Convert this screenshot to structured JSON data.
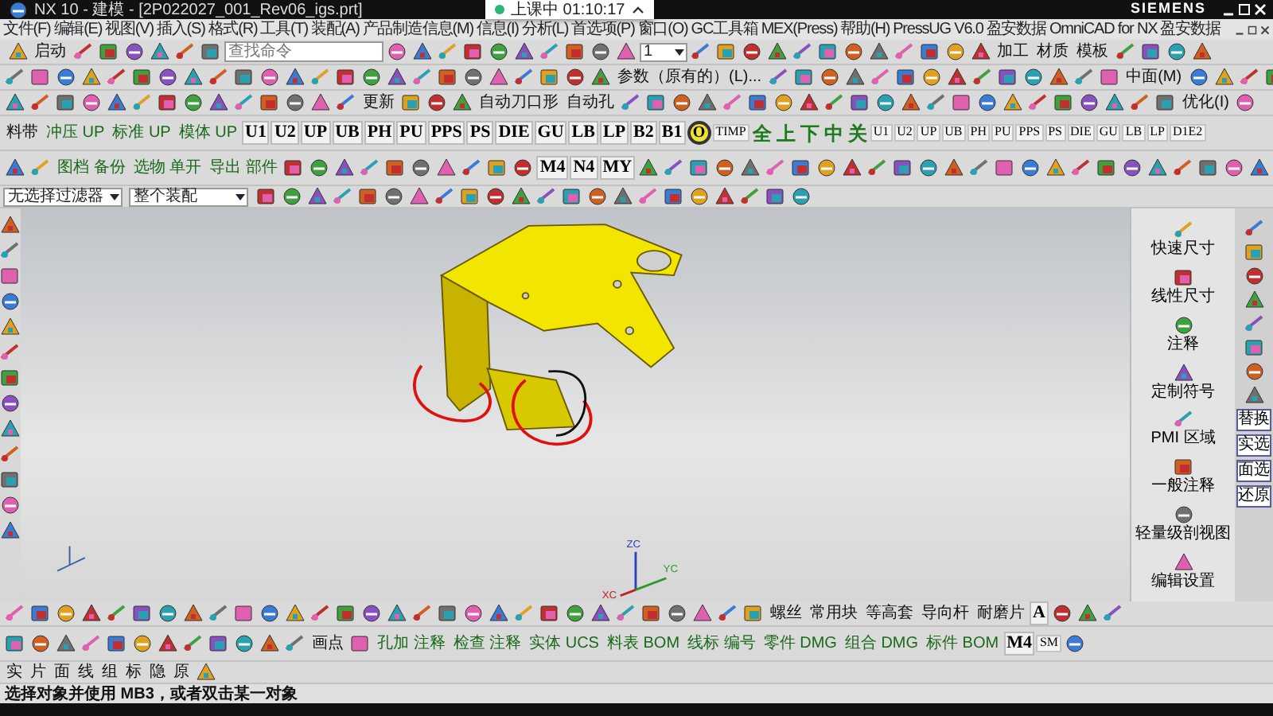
{
  "window": {
    "title": "NX 10 - 建模 - [2P022027_001_Rev06_igs.prt]",
    "brand": "SIEMENS"
  },
  "notification": {
    "text": "上课中 01:10:17"
  },
  "menu": [
    "文件(F)",
    "编辑(E)",
    "视图(V)",
    "插入(S)",
    "格式(R)",
    "工具(T)",
    "装配(A)",
    "产品制造信息(M)",
    "信息(I)",
    "分析(L)",
    "首选项(P)",
    "窗口(O)",
    "GC工具箱",
    "MEX(Press)",
    "帮助(H)",
    "PressUG V6.0",
    "盈安数据",
    "OmniCAD for NX",
    "盈安数据"
  ],
  "toolbars": [
    [
      {
        "kind": "button",
        "text": "启动"
      },
      {
        "kind": "search",
        "placeholder": "查找命令"
      },
      {
        "kind": "dropdown",
        "text": "1"
      },
      {
        "kind": "label",
        "text": "加工"
      },
      {
        "kind": "label",
        "text": "材质"
      },
      {
        "kind": "label",
        "text": "模板"
      }
    ],
    [
      {
        "kind": "label",
        "text": "参数（原有的）(L)..."
      },
      {
        "kind": "label",
        "text": "中面(M)"
      }
    ],
    [
      {
        "kind": "label",
        "text": "更新"
      },
      {
        "kind": "label",
        "text": "自动刀口形"
      },
      {
        "kind": "label",
        "text": "自动孔"
      },
      {
        "kind": "label",
        "text": "优化(I)"
      }
    ],
    [
      {
        "kind": "label",
        "text": "料带"
      },
      {
        "kind": "stack",
        "text": "冲压 UP"
      },
      {
        "kind": "stack",
        "text": "标准 UP"
      },
      {
        "kind": "stack",
        "text": "模体 UP"
      },
      {
        "kind": "code",
        "text": "U1"
      },
      {
        "kind": "code",
        "text": "U2"
      },
      {
        "kind": "code",
        "text": "UP"
      },
      {
        "kind": "code",
        "text": "UB"
      },
      {
        "kind": "code",
        "text": "PH"
      },
      {
        "kind": "code",
        "text": "PU"
      },
      {
        "kind": "code",
        "text": "PPS"
      },
      {
        "kind": "code",
        "text": "PS"
      },
      {
        "kind": "code",
        "text": "DIE"
      },
      {
        "kind": "code",
        "text": "GU"
      },
      {
        "kind": "code",
        "text": "LB"
      },
      {
        "kind": "code",
        "text": "LP"
      },
      {
        "kind": "code",
        "text": "B2"
      },
      {
        "kind": "code",
        "text": "B1"
      },
      {
        "kind": "ring",
        "text": "O"
      },
      {
        "kind": "small",
        "text": "TIMP"
      },
      {
        "kind": "glyph",
        "text": "全"
      },
      {
        "kind": "glyph",
        "text": "上"
      },
      {
        "kind": "glyph",
        "text": "下"
      },
      {
        "kind": "glyph",
        "text": "中"
      },
      {
        "kind": "glyph",
        "text": "关"
      },
      {
        "kind": "small",
        "text": "U1"
      },
      {
        "kind": "small",
        "text": "U2"
      },
      {
        "kind": "small",
        "text": "UP"
      },
      {
        "kind": "small",
        "text": "UB"
      },
      {
        "kind": "small",
        "text": "PH"
      },
      {
        "kind": "small",
        "text": "PU"
      },
      {
        "kind": "small",
        "text": "PPS"
      },
      {
        "kind": "small",
        "text": "PS"
      },
      {
        "kind": "small",
        "text": "DIE"
      },
      {
        "kind": "small",
        "text": "GU"
      },
      {
        "kind": "small",
        "text": "LB"
      },
      {
        "kind": "small",
        "text": "LP"
      },
      {
        "kind": "small",
        "text": "D1E2"
      }
    ],
    [
      {
        "kind": "stack",
        "text": "图档 备份"
      },
      {
        "kind": "stack",
        "text": "选物 单开"
      },
      {
        "kind": "stack",
        "text": "导出 部件"
      },
      {
        "kind": "code",
        "text": "M4"
      },
      {
        "kind": "code",
        "text": "N4"
      },
      {
        "kind": "code",
        "text": "MY"
      }
    ],
    [
      {
        "kind": "filter",
        "text": "无选择过滤器"
      },
      {
        "kind": "filter",
        "text": "整个装配"
      }
    ]
  ],
  "right_panel": [
    "快速尺寸",
    "线性尺寸",
    "注释",
    "定制符号",
    "PMI 区域",
    "一般注释",
    "轻量级剖视图",
    "编辑设置"
  ],
  "side_buttons": [
    "替换",
    "实选",
    "面选",
    "还原"
  ],
  "triad": {
    "z": "ZC",
    "y": "YC",
    "x": "XC"
  },
  "bottom_toolbars": [
    [
      {
        "kind": "label",
        "text": "螺丝"
      },
      {
        "kind": "label",
        "text": "常用块"
      },
      {
        "kind": "label",
        "text": "等高套"
      },
      {
        "kind": "label",
        "text": "导向杆"
      },
      {
        "kind": "label",
        "text": "耐磨片"
      },
      {
        "kind": "code",
        "text": "A"
      }
    ],
    [
      {
        "kind": "label",
        "text": "画点"
      },
      {
        "kind": "stack",
        "text": "孔加 注释"
      },
      {
        "kind": "stack",
        "text": "检查 注释"
      },
      {
        "kind": "stack",
        "text": "实体 UCS"
      },
      {
        "kind": "stack",
        "text": "料表 BOM"
      },
      {
        "kind": "stack",
        "text": "线标 编号"
      },
      {
        "kind": "stack",
        "text": "零件 DMG"
      },
      {
        "kind": "stack",
        "text": "组合 DMG"
      },
      {
        "kind": "stack",
        "text": "标件 BOM"
      },
      {
        "kind": "code",
        "text": "M4"
      },
      {
        "kind": "small",
        "text": "SM"
      }
    ],
    [
      {
        "kind": "label",
        "text": "实"
      },
      {
        "kind": "label",
        "text": "片"
      },
      {
        "kind": "label",
        "text": "面"
      },
      {
        "kind": "label",
        "text": "线"
      },
      {
        "kind": "label",
        "text": "组"
      },
      {
        "kind": "label",
        "text": "标"
      },
      {
        "kind": "label",
        "text": "隐"
      },
      {
        "kind": "label",
        "text": "原"
      }
    ]
  ],
  "status_bar": "选择对象并使用 MB3，或者双击某一对象"
}
